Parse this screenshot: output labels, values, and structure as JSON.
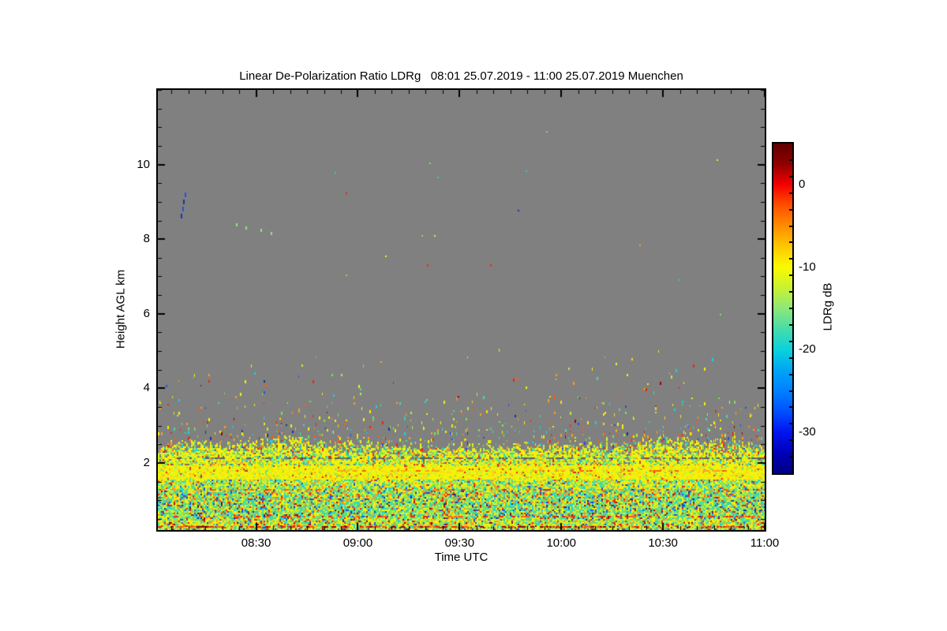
{
  "chart_data": {
    "type": "heatmap",
    "title": "Linear De-Polarization Ratio LDRg   08:01 25.07.2019 - 11:00 25.07.2019 Muenchen",
    "xlabel": "Time UTC",
    "ylabel": "Height AGL km",
    "station": "Muenchen",
    "time_start": "08:01 25.07.2019",
    "time_end": "11:00 25.07.2019",
    "x_axis": {
      "start_minutes": 481,
      "end_minutes": 660,
      "minor_step_minutes": 5,
      "major_ticks": [
        {
          "minutes": 510,
          "label": "08:30"
        },
        {
          "minutes": 540,
          "label": "09:00"
        },
        {
          "minutes": 570,
          "label": "09:30"
        },
        {
          "minutes": 600,
          "label": "10:00"
        },
        {
          "minutes": 630,
          "label": "10:30"
        },
        {
          "minutes": 660,
          "label": "11:00"
        }
      ]
    },
    "y_axis": {
      "min_km": 0.2,
      "max_km": 12,
      "minor_step_km": 0.5,
      "major_ticks": [
        {
          "value": 2,
          "label": "2"
        },
        {
          "value": 4,
          "label": "4"
        },
        {
          "value": 6,
          "label": "6"
        },
        {
          "value": 8,
          "label": "8"
        },
        {
          "value": 10,
          "label": "10"
        }
      ]
    },
    "colorbar": {
      "label": "LDRg dB",
      "min": -35,
      "max": 5,
      "minor_step": 2,
      "major_ticks": [
        {
          "value": 0,
          "label": "0"
        },
        {
          "value": -10,
          "label": "-10"
        },
        {
          "value": -20,
          "label": "-20"
        },
        {
          "value": -30,
          "label": "-30"
        }
      ],
      "gradient_stops": [
        [
          0.0,
          "#600000"
        ],
        [
          0.0625,
          "#8f0000"
        ],
        [
          0.125,
          "#f50000"
        ],
        [
          0.1875,
          "#ff5000"
        ],
        [
          0.25,
          "#ff8c00"
        ],
        [
          0.3125,
          "#ffc800"
        ],
        [
          0.375,
          "#fafa00"
        ],
        [
          0.4375,
          "#c8f232"
        ],
        [
          0.5,
          "#8ce878"
        ],
        [
          0.5625,
          "#46dcaa"
        ],
        [
          0.625,
          "#0ad2dc"
        ],
        [
          0.6875,
          "#00a5f5"
        ],
        [
          0.75,
          "#0080ff"
        ],
        [
          0.8125,
          "#0050ff"
        ],
        [
          0.875,
          "#0014f0"
        ],
        [
          0.9375,
          "#0000b9"
        ],
        [
          1.0,
          "#000082"
        ]
      ]
    },
    "no_data_color": "#808080",
    "axis_color": "#000000",
    "seed": 42,
    "palette": {
      "yellow": "#f2f20a",
      "gold": "#ffd70a",
      "yellowgreen": "#bdec3f",
      "green": "#78e062",
      "teal": "#46dca0",
      "cyan": "#1ed2dc",
      "lightblue": "#00a0f0",
      "blue": "#2350e0",
      "darkblue": "#1430a0",
      "orange": "#ff9b1e",
      "redorange": "#ff5a14",
      "red": "#e6280f",
      "darkred": "#a00000",
      "gray2": "#6f6f6f",
      "darkgray": "#5a5a5a"
    },
    "bands": [
      {
        "h0": 0.2,
        "h1": 0.5,
        "density": 1.0,
        "weights": {
          "yellow": 26,
          "yellowgreen": 20,
          "green": 16,
          "teal": 10,
          "cyan": 7,
          "orange": 8,
          "red": 5,
          "darkred": 3,
          "blue": 3,
          "gold": 2
        }
      },
      {
        "h0": 0.5,
        "h1": 0.95,
        "density": 1.0,
        "weights": {
          "yellow": 20,
          "yellowgreen": 12,
          "green": 18,
          "teal": 16,
          "cyan": 13,
          "orange": 6,
          "red": 5,
          "blue": 5,
          "darkblue": 2,
          "darkred": 3
        }
      },
      {
        "h0": 0.95,
        "h1": 1.3,
        "density": 1.0,
        "weights": {
          "yellow": 22,
          "yellowgreen": 12,
          "green": 16,
          "teal": 14,
          "cyan": 11,
          "orange": 8,
          "red": 7,
          "redorange": 3,
          "blue": 5,
          "darkblue": 2
        }
      },
      {
        "h0": 1.3,
        "h1": 1.55,
        "density": 1.0,
        "weights": {
          "yellow": 32,
          "yellowgreen": 16,
          "green": 14,
          "teal": 12,
          "cyan": 9,
          "orange": 6,
          "red": 4,
          "blue": 4,
          "gold": 3
        }
      },
      {
        "h0": 1.55,
        "h1": 1.95,
        "density": 1.0,
        "weights": {
          "yellow": 68,
          "gold": 12,
          "yellowgreen": 10,
          "green": 5,
          "orange": 3,
          "red": 2
        }
      },
      {
        "h0": 1.95,
        "h1": 2.25,
        "density": 0.93,
        "weights": {
          "yellow": 48,
          "yellowgreen": 14,
          "green": 11,
          "teal": 6,
          "cyan": 5,
          "orange": 6,
          "red": 3,
          "gray2": 5,
          "gold": 2
        }
      },
      {
        "h0": 2.25,
        "h1": null,
        "density": 0.8,
        "weights": {
          "yellow": 52,
          "yellowgreen": 12,
          "green": 10,
          "teal": 6,
          "cyan": 7,
          "orange": 7,
          "red": 3,
          "redorange": 2,
          "blue": 1
        }
      }
    ],
    "boundary_points": [
      [
        0,
        2.55
      ],
      [
        9,
        2.6
      ],
      [
        19,
        2.5
      ],
      [
        39,
        2.78
      ],
      [
        49,
        2.6
      ],
      [
        69,
        2.5
      ],
      [
        99,
        2.45
      ],
      [
        119,
        2.5
      ],
      [
        139,
        2.55
      ],
      [
        149,
        2.7
      ],
      [
        164,
        2.6
      ],
      [
        179,
        2.5
      ]
    ],
    "sparse": {
      "h_max": 5.15,
      "p0": 0.1,
      "scale_km": 0.6,
      "weights": {
        "yellow": 26,
        "gold": 4,
        "orange": 16,
        "redorange": 7,
        "red": 10,
        "cyan": 13,
        "teal": 8,
        "green": 10,
        "yellowgreen": 7,
        "blue": 5,
        "darkblue": 2,
        "darkred": 2
      }
    },
    "high_sparse": {
      "h_min": 5.15,
      "h_max": 11.9,
      "p": 0.00028,
      "weights": {
        "yellow": 25,
        "orange": 18,
        "red": 12,
        "cyan": 18,
        "green": 15,
        "blue": 8,
        "darkblue": 4
      }
    },
    "lines": [
      {
        "h": 0.28,
        "colors": [
          "darkred",
          "red",
          "redorange"
        ],
        "coverage": 0.5,
        "thickness": 2
      },
      {
        "h": 0.55,
        "colors": [
          "red",
          "redorange"
        ],
        "coverage": 0.3,
        "thickness": 2
      },
      {
        "h": 1.28,
        "colors": [
          "red",
          "orange",
          "redorange"
        ],
        "coverage": 0.22,
        "thickness": 2
      },
      {
        "h": 1.78,
        "colors": [
          "orange",
          "redorange"
        ],
        "coverage": 0.3,
        "thickness": 2,
        "t0": 50,
        "t1": 168
      },
      {
        "h": 2.12,
        "colors": [
          "gray2",
          "darkgray"
        ],
        "coverage": 0.42,
        "thickness": 2
      }
    ],
    "features": {
      "blue_streak": {
        "color": "#2850dc",
        "color2": "#1434b4",
        "points": [
          [
            8.1,
            9.25
          ],
          [
            7.75,
            9.05
          ],
          [
            7.4,
            8.88
          ],
          [
            7.0,
            8.68
          ]
        ]
      },
      "green_dots": {
        "color": "#96e67d",
        "positions": [
          [
            23.3,
            8.42
          ],
          [
            26.1,
            8.35
          ],
          [
            30.5,
            8.28
          ],
          [
            33.5,
            8.2
          ]
        ]
      },
      "red_dots": {
        "color": "#f03214",
        "positions": [
          [
            79.6,
            7.33
          ],
          [
            98.2,
            7.33
          ]
        ]
      }
    }
  }
}
